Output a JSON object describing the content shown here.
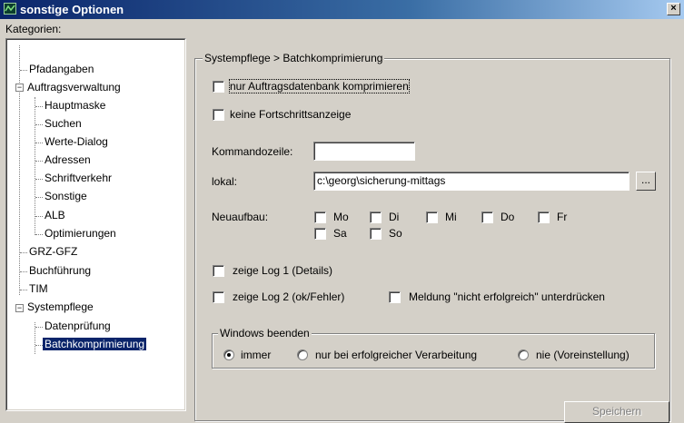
{
  "window": {
    "title": "sonstige Optionen",
    "close_label": "×"
  },
  "sidebar": {
    "header": "Kategorien:",
    "items": [
      {
        "label": "Pfadangaben"
      },
      {
        "label": "Auftragsverwaltung",
        "expander": "−"
      },
      {
        "label": "Hauptmaske"
      },
      {
        "label": "Suchen"
      },
      {
        "label": "Werte-Dialog"
      },
      {
        "label": "Adressen"
      },
      {
        "label": "Schriftverkehr"
      },
      {
        "label": "Sonstige"
      },
      {
        "label": "ALB"
      },
      {
        "label": "Optimierungen"
      },
      {
        "label": "GRZ-GFZ"
      },
      {
        "label": "Buchführung"
      },
      {
        "label": "TIM"
      },
      {
        "label": "Systempflege",
        "expander": "−"
      },
      {
        "label": "Datenprüfung"
      },
      {
        "label": "Batchkomprimierung",
        "selected": true
      }
    ]
  },
  "panel": {
    "title": "Systempflege > Batchkomprimierung",
    "cb_only_orders": "nur Auftragsdatenbank komprimieren",
    "cb_no_progress": "keine Fortschrittsanzeige",
    "cmdline_label": "Kommandozeile:",
    "cmdline_value": "",
    "local_label": "lokal:",
    "local_value": "c:\\georg\\sicherung-mittags",
    "browse_label": "...",
    "rebuild_label": "Neuaufbau:",
    "days": [
      "Mo",
      "Di",
      "Mi",
      "Do",
      "Fr",
      "Sa",
      "So"
    ],
    "cb_log1": "zeige Log 1 (Details)",
    "cb_log2": "zeige Log 2 (ok/Fehler)",
    "cb_suppress": "Meldung \"nicht erfolgreich\" unterdrücken",
    "shutdown_group": "Windows beenden",
    "radio_always": "immer",
    "radio_success_only": "nur bei erfolgreicher Verarbeitung",
    "radio_never": "nie (Voreinstellung)",
    "save_label": "Speichern"
  }
}
